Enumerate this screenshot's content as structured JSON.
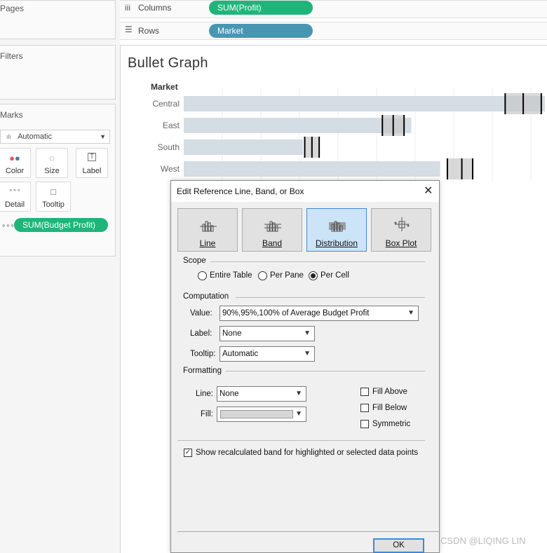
{
  "left": {
    "pages_title": "Pages",
    "filters_title": "Filters",
    "marks_title": "Marks",
    "mark_type": "Automatic",
    "buttons": {
      "color": "Color",
      "size": "Size",
      "label": "Label",
      "detail": "Detail",
      "tooltip": "Tooltip"
    },
    "detail_pill": "SUM(Budget Profit)"
  },
  "shelves": {
    "columns_label": "Columns",
    "columns_pill": "SUM(Profit)",
    "rows_label": "Rows",
    "rows_pill": "Market"
  },
  "sheet": {
    "title": "Bullet Graph",
    "row_header": "Market"
  },
  "chart_data": {
    "type": "bar",
    "categories": [
      "Central",
      "East",
      "South",
      "West"
    ],
    "bar_fraction_of_width": [
      1.0,
      0.63,
      0.33,
      0.71
    ],
    "reference_fraction_of_width": [
      [
        0.89,
        0.94,
        0.99
      ],
      [
        0.55,
        0.58,
        0.61
      ],
      [
        0.335,
        0.355,
        0.375
      ],
      [
        0.73,
        0.77,
        0.8
      ]
    ],
    "bar_color": "#d4dce4",
    "band_color": "#c8c8c8",
    "line_color": "#000000"
  },
  "dialog": {
    "title": "Edit Reference Line, Band, or Box",
    "types": [
      {
        "label": "Line",
        "selected": false
      },
      {
        "label": "Band",
        "selected": false
      },
      {
        "label": "Distribution",
        "selected": true
      },
      {
        "label": "Box Plot",
        "selected": false
      }
    ],
    "scope_title": "Scope",
    "scope_options": [
      "Entire Table",
      "Per Pane",
      "Per Cell"
    ],
    "scope_selected": "Per Cell",
    "computation_title": "Computation",
    "value_label": "Value:",
    "value": "90%,95%,100% of Average Budget Profit",
    "label_label": "Label:",
    "label_value": "None",
    "tooltip_label": "Tooltip:",
    "tooltip_value": "Automatic",
    "formatting_title": "Formatting",
    "line_label": "Line:",
    "line_value": "None",
    "fill_label": "Fill:",
    "fill_above": "Fill Above",
    "fill_below": "Fill Below",
    "symmetric": "Symmetric",
    "show_recalc": "Show recalculated band for highlighted or selected data points",
    "ok": "OK"
  },
  "watermark": "CSDN @LIQING LIN",
  "colors": {
    "measure_pill": "#1fb57a",
    "dimension_pill": "#4996b2",
    "selected_tab": "#cce4f7"
  }
}
